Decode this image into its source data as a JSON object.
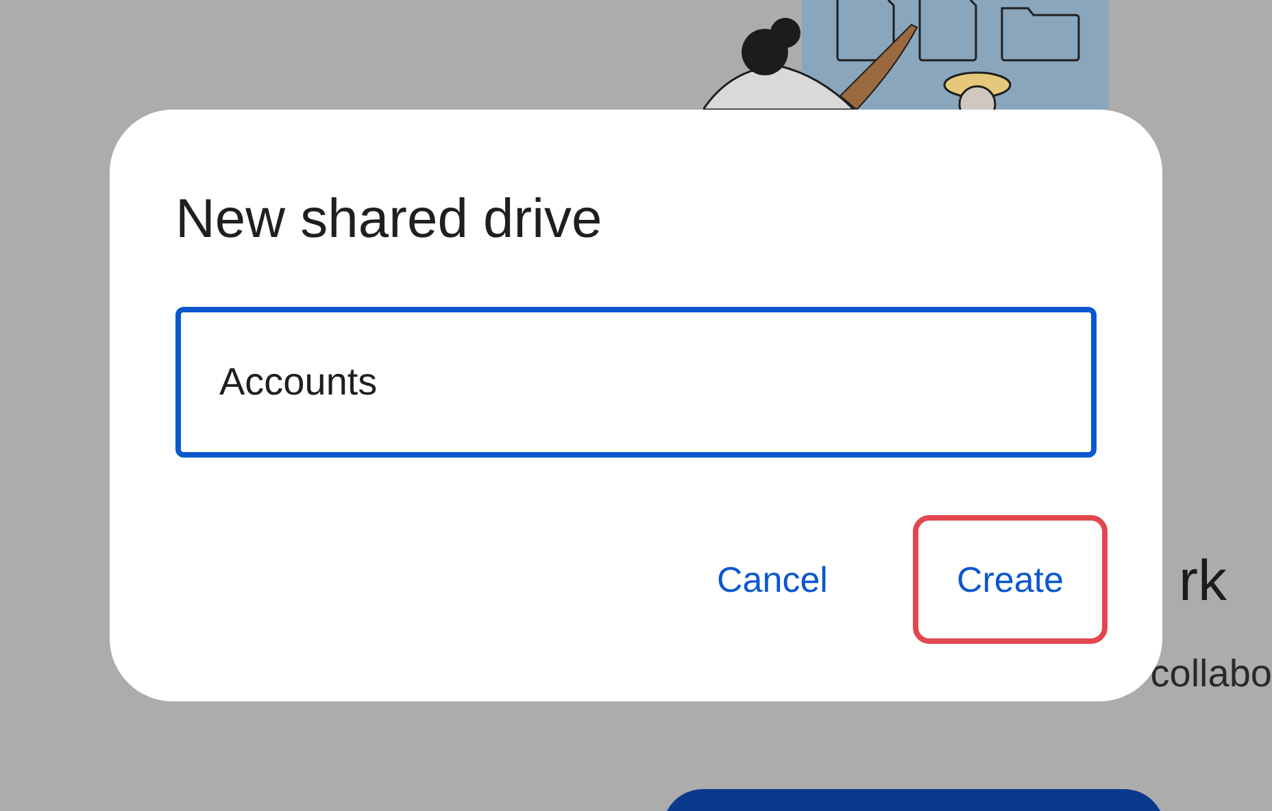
{
  "background": {
    "heading": "rk",
    "description": "collabo"
  },
  "dialog": {
    "title": "New shared drive",
    "name_field": {
      "value": "Accounts",
      "focused": true
    },
    "buttons": [
      {
        "label": "Cancel",
        "highlighted": false
      },
      {
        "label": "Create",
        "highlighted": true
      }
    ]
  }
}
